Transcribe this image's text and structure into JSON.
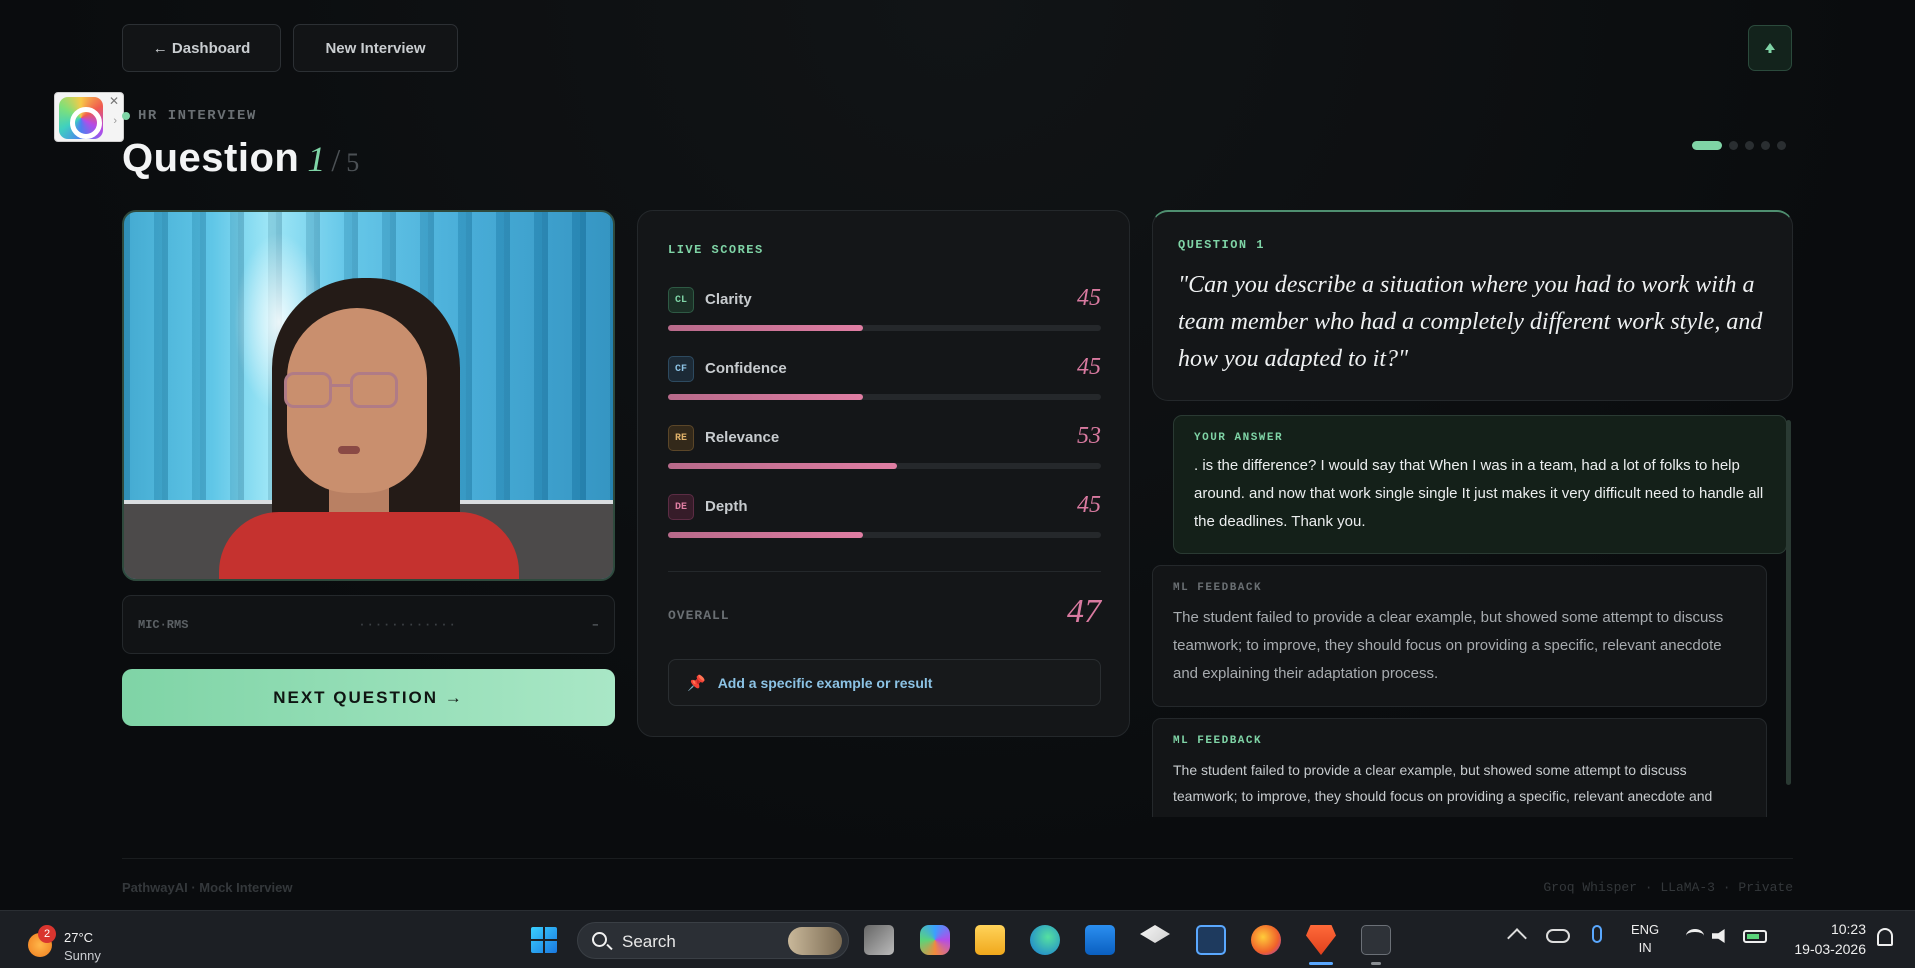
{
  "nav": {
    "back_label": "← Dashboard",
    "new_label": "New Interview"
  },
  "header": {
    "eyebrow": "HR INTERVIEW",
    "title_word": "Question",
    "current": "1",
    "slash": "/",
    "total": "5",
    "progress_current": 1,
    "progress_total": 5
  },
  "webcam": {
    "mic_label": "MIC·RMS",
    "mic_meter": "············",
    "mic_value": "–"
  },
  "next_button": "NEXT QUESTION →",
  "scores": {
    "heading": "LIVE SCORES",
    "items": [
      {
        "code": "CL",
        "name": "Clarity",
        "value": "45",
        "pct": 45
      },
      {
        "code": "CF",
        "name": "Confidence",
        "value": "45",
        "pct": 45
      },
      {
        "code": "RE",
        "name": "Relevance",
        "value": "53",
        "pct": 53
      },
      {
        "code": "DE",
        "name": "Depth",
        "value": "45",
        "pct": 45
      }
    ],
    "overall_label": "OVERALL",
    "overall_value": "47",
    "tip": "Add a specific example or result"
  },
  "question": {
    "label": "QUESTION 1",
    "text": "\"Can you describe a situation where you had to work with a team member who had a completely different work style, and how you adapted to it?\""
  },
  "answer": {
    "label": "YOUR ANSWER",
    "text": ". is the difference? I would say that When I was in a team, had a lot of folks to help around. and now that work single single It just makes it very difficult need to handle all the deadlines. Thank you."
  },
  "feedback": [
    {
      "label": "ML FEEDBACK",
      "text": "The student failed to provide a clear example, but showed some attempt to discuss teamwork; to improve, they should focus on providing a specific, relevant anecdote and explaining their adaptation process."
    },
    {
      "label": "ML FEEDBACK",
      "text": "The student failed to provide a clear example, but showed some attempt to discuss teamwork; to improve, they should focus on providing a specific, relevant anecdote and explaining their adaptation process."
    }
  ],
  "footer": {
    "left": "PathwayAI · Mock Interview",
    "right": "Groq Whisper · LLaMA-3 · Private"
  },
  "taskbar": {
    "weather_badge": "2",
    "temperature": "27°C",
    "condition": "Sunny",
    "search_label": "Search",
    "lang_top": "ENG",
    "lang_bottom": "IN",
    "time": "10:23",
    "date": "19-03-2026"
  },
  "colors": {
    "accent_green": "#7fd4a6",
    "score_pink": "#d97aa0",
    "tip_blue": "#8cc3e5"
  }
}
